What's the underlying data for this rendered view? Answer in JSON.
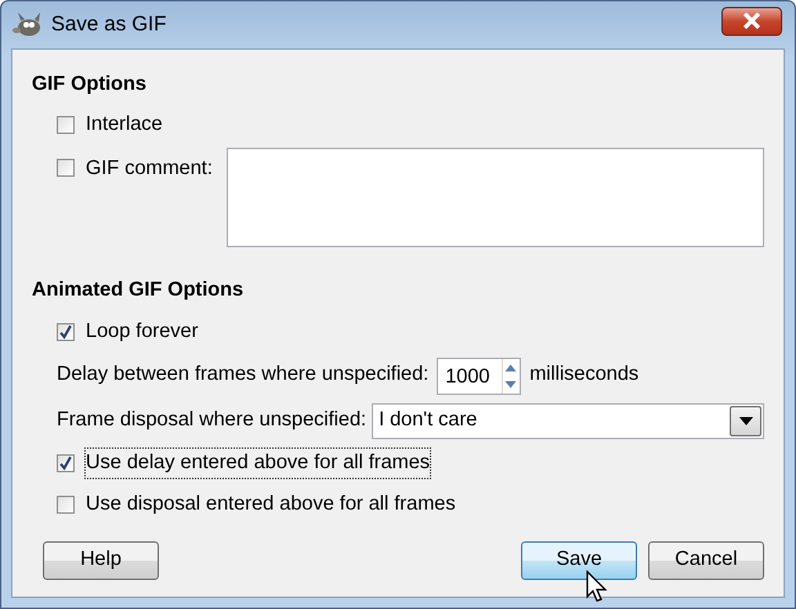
{
  "window": {
    "title": "Save as GIF"
  },
  "gif_options": {
    "heading": "GIF Options",
    "interlace": {
      "label": "Interlace",
      "checked": false
    },
    "comment": {
      "label": "GIF comment:",
      "checked": false
    }
  },
  "animated_options": {
    "heading": "Animated GIF Options",
    "loop": {
      "label": "Loop forever",
      "checked": true
    },
    "delay": {
      "label": "Delay between frames where unspecified:",
      "value": "1000",
      "unit": "milliseconds"
    },
    "disposal": {
      "label": "Frame disposal where unspecified:",
      "value": "I don't care"
    },
    "use_delay": {
      "label": "Use delay entered above for all frames",
      "checked": true,
      "focused": true
    },
    "use_disposal": {
      "label": "Use disposal entered above for all frames",
      "checked": false
    }
  },
  "buttons": [
    {
      "label": "Help",
      "default": false
    },
    {
      "label": "Save",
      "default": true
    },
    {
      "label": "Cancel",
      "default": false
    }
  ]
}
